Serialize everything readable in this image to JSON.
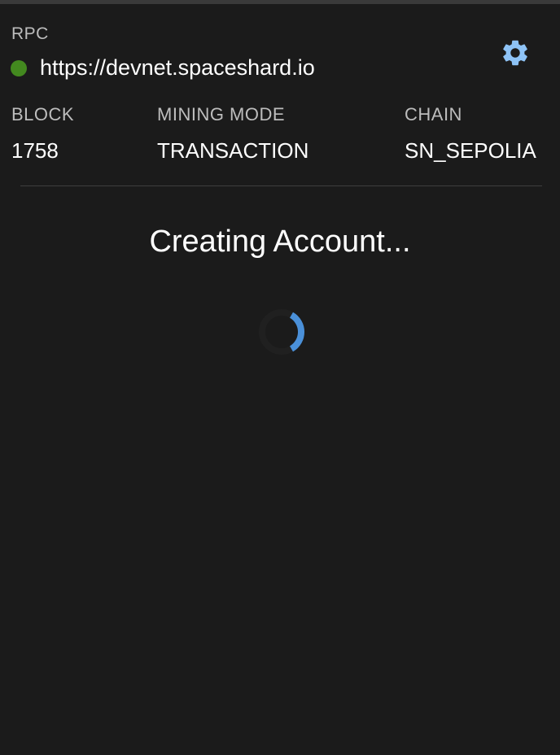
{
  "rpc": {
    "label": "RPC",
    "url": "https://devnet.spaceshard.io",
    "status_color": "#43891f"
  },
  "settings": {
    "icon": "gear-icon",
    "color": "#8ec3f6"
  },
  "info": {
    "block": {
      "label": "BLOCK",
      "value": "1758"
    },
    "mining_mode": {
      "label": "MINING MODE",
      "value": "TRANSACTION"
    },
    "chain": {
      "label": "CHAIN",
      "value": "SN_SEPOLIA"
    }
  },
  "status": {
    "message": "Creating Account..."
  },
  "spinner": {
    "icon": "loading-spinner-icon",
    "color": "#4a90d9"
  }
}
